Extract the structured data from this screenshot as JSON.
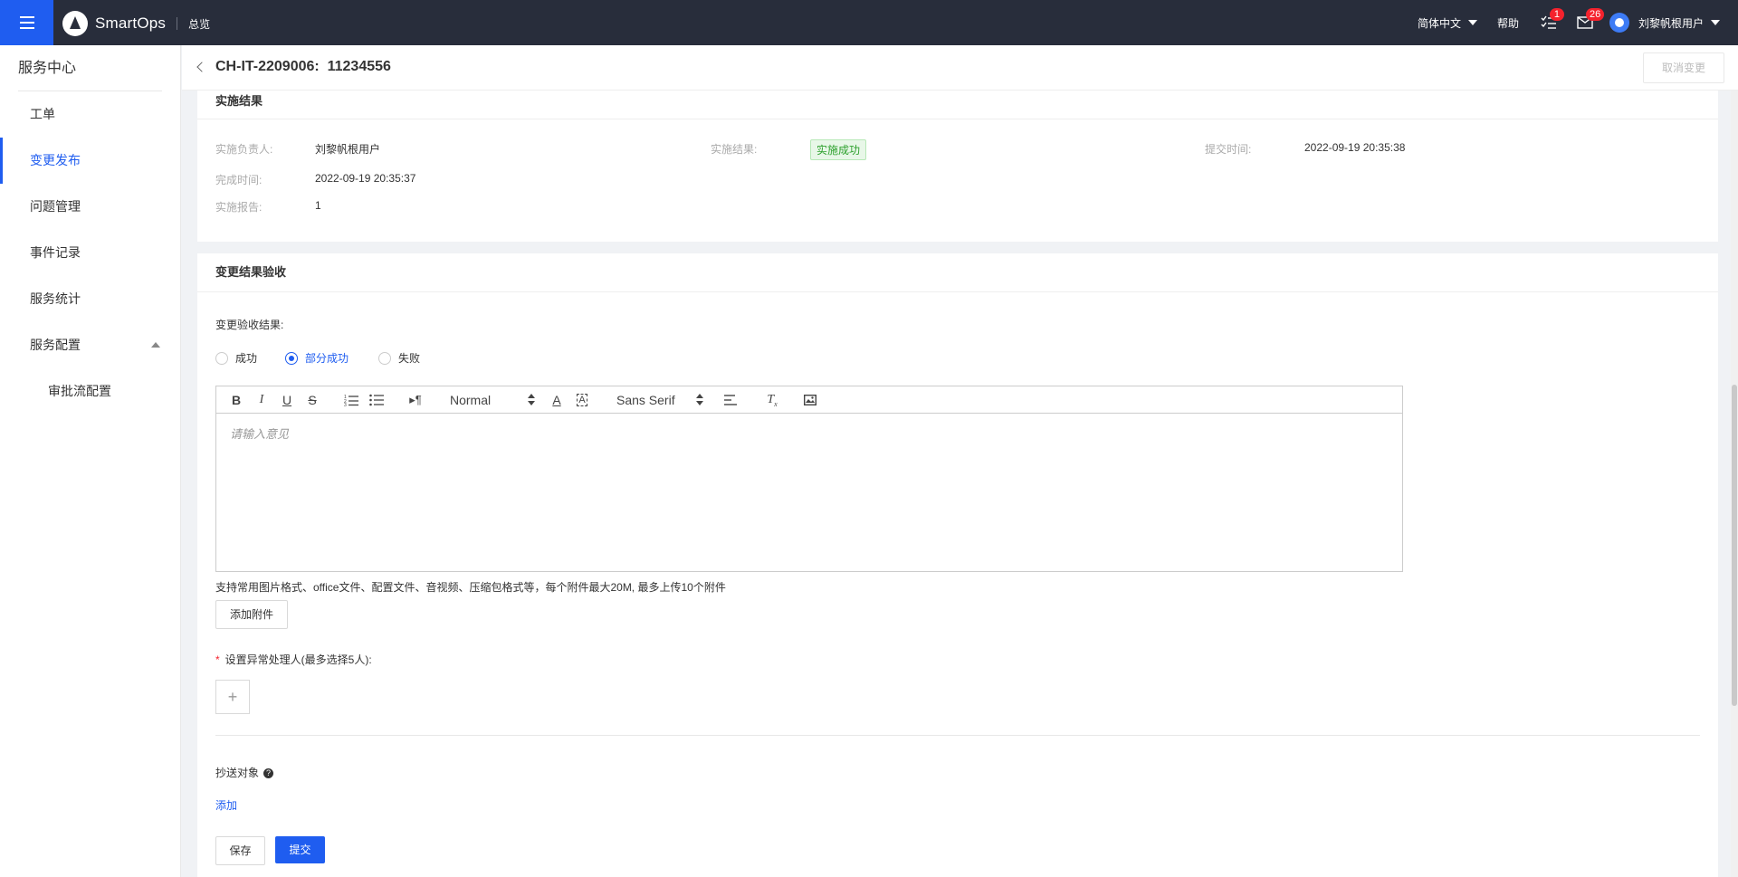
{
  "header": {
    "brand": "SmartOps",
    "overview": "总览",
    "language": "简体中文",
    "help": "帮助",
    "todo_badge": "1",
    "message_badge": "26",
    "username": "刘黎帆根用户"
  },
  "sidebar": {
    "title": "服务中心",
    "items": [
      {
        "label": "工单"
      },
      {
        "label": "变更发布"
      },
      {
        "label": "问题管理"
      },
      {
        "label": "事件记录"
      },
      {
        "label": "服务统计"
      },
      {
        "label": "服务配置"
      }
    ],
    "sub_items": [
      {
        "label": "审批流配置"
      }
    ]
  },
  "page": {
    "title": "CH-IT-2209006:  11234556",
    "cancel_button": "取消变更"
  },
  "result_section": {
    "title": "实施结果",
    "owner_label": "实施负责人:",
    "owner_value": "刘黎帆根用户",
    "result_label": "实施结果:",
    "result_value": "实施成功",
    "submit_time_label": "提交时间:",
    "submit_time_value": "2022-09-19 20:35:38",
    "finish_time_label": "完成时间:",
    "finish_time_value": "2022-09-19 20:35:37",
    "report_label": "实施报告:",
    "report_value": "1"
  },
  "acceptance_section": {
    "title": "变更结果验收",
    "result_label": "变更验收结果:",
    "options": [
      {
        "label": "成功",
        "checked": false
      },
      {
        "label": "部分成功",
        "checked": true
      },
      {
        "label": "失败",
        "checked": false
      }
    ],
    "editor": {
      "header_select": "Normal",
      "font_select": "Sans Serif",
      "placeholder": "请输入意见"
    },
    "attachment_hint": "支持常用图片格式、office文件、配置文件、音视频、压缩包格式等，每个附件最大20M, 最多上传10个附件",
    "add_attachment": "添加附件",
    "handler_label": "设置异常处理人(最多选择5人):",
    "cc_label": "抄送对象",
    "add_link": "添加",
    "save_button": "保存",
    "submit_button": "提交"
  },
  "colors": {
    "topbar": "#282d3b",
    "accent": "#1f5df0",
    "success": "#2ea12e",
    "badge": "#f5222d"
  }
}
